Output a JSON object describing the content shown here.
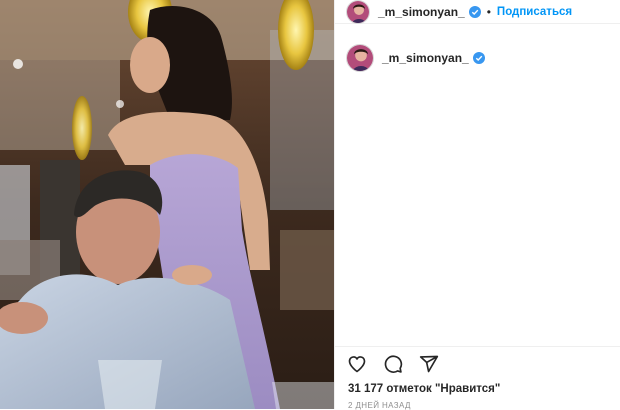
{
  "post": {
    "author": {
      "username": "_m_simonyan_",
      "verified": true,
      "follow_label": "Подписаться",
      "separator": "•"
    },
    "caption": {
      "username": "_m_simonyan_"
    },
    "actions": {
      "icons": [
        "heart-icon",
        "comment-icon",
        "share-icon"
      ]
    },
    "likes_text": "31 177 отметок \"Нравится\"",
    "timestamp": "2 ДНЕЙ НАЗАД"
  },
  "colors": {
    "accent": "#0095f6",
    "text": "#262626",
    "muted": "#8e8e8e",
    "divider": "#efefef"
  }
}
